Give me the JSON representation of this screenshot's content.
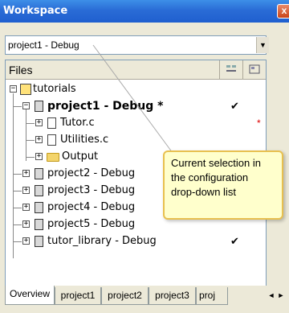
{
  "window": {
    "title": "Workspace",
    "close_glyph": "x"
  },
  "config_combo": {
    "value": "project1 - Debug",
    "arrow": "▼"
  },
  "tree": {
    "header": {
      "files_label": "Files"
    },
    "rows": [
      {
        "label": "tutorials",
        "expander": "−",
        "icon": "workspace-icon",
        "check": "",
        "dirty": ""
      },
      {
        "label": "project1 - Debug *",
        "expander": "−",
        "icon": "project-icon",
        "check": "✔",
        "dirty": ""
      },
      {
        "label": "Tutor.c",
        "expander": "+",
        "icon": "file-icon",
        "check": "",
        "dirty": "*"
      },
      {
        "label": "Utilities.c",
        "expander": "+",
        "icon": "file-icon",
        "check": "",
        "dirty": ""
      },
      {
        "label": "Output",
        "expander": "+",
        "icon": "folder-icon",
        "check": "",
        "dirty": ""
      },
      {
        "label": "project2 - Debug",
        "expander": "+",
        "icon": "project-icon",
        "check": "",
        "dirty": ""
      },
      {
        "label": "project3 - Debug",
        "expander": "+",
        "icon": "project-icon",
        "check": "",
        "dirty": ""
      },
      {
        "label": "project4 - Debug",
        "expander": "+",
        "icon": "project-icon",
        "check": "",
        "dirty": ""
      },
      {
        "label": "project5 - Debug",
        "expander": "+",
        "icon": "project-icon",
        "check": "",
        "dirty": ""
      },
      {
        "label": "tutor_library - Debug",
        "expander": "+",
        "icon": "project-icon",
        "check": "✔",
        "dirty": ""
      }
    ]
  },
  "tooltip": {
    "text": "Current selection in the configuration drop-down list"
  },
  "tabs": [
    {
      "label": "Overview",
      "active": true
    },
    {
      "label": "project1",
      "active": false
    },
    {
      "label": "project2",
      "active": false
    },
    {
      "label": "project3",
      "active": false
    },
    {
      "label": "proj",
      "active": false
    }
  ],
  "tab_scroll": {
    "left": "◄",
    "right": "►"
  }
}
